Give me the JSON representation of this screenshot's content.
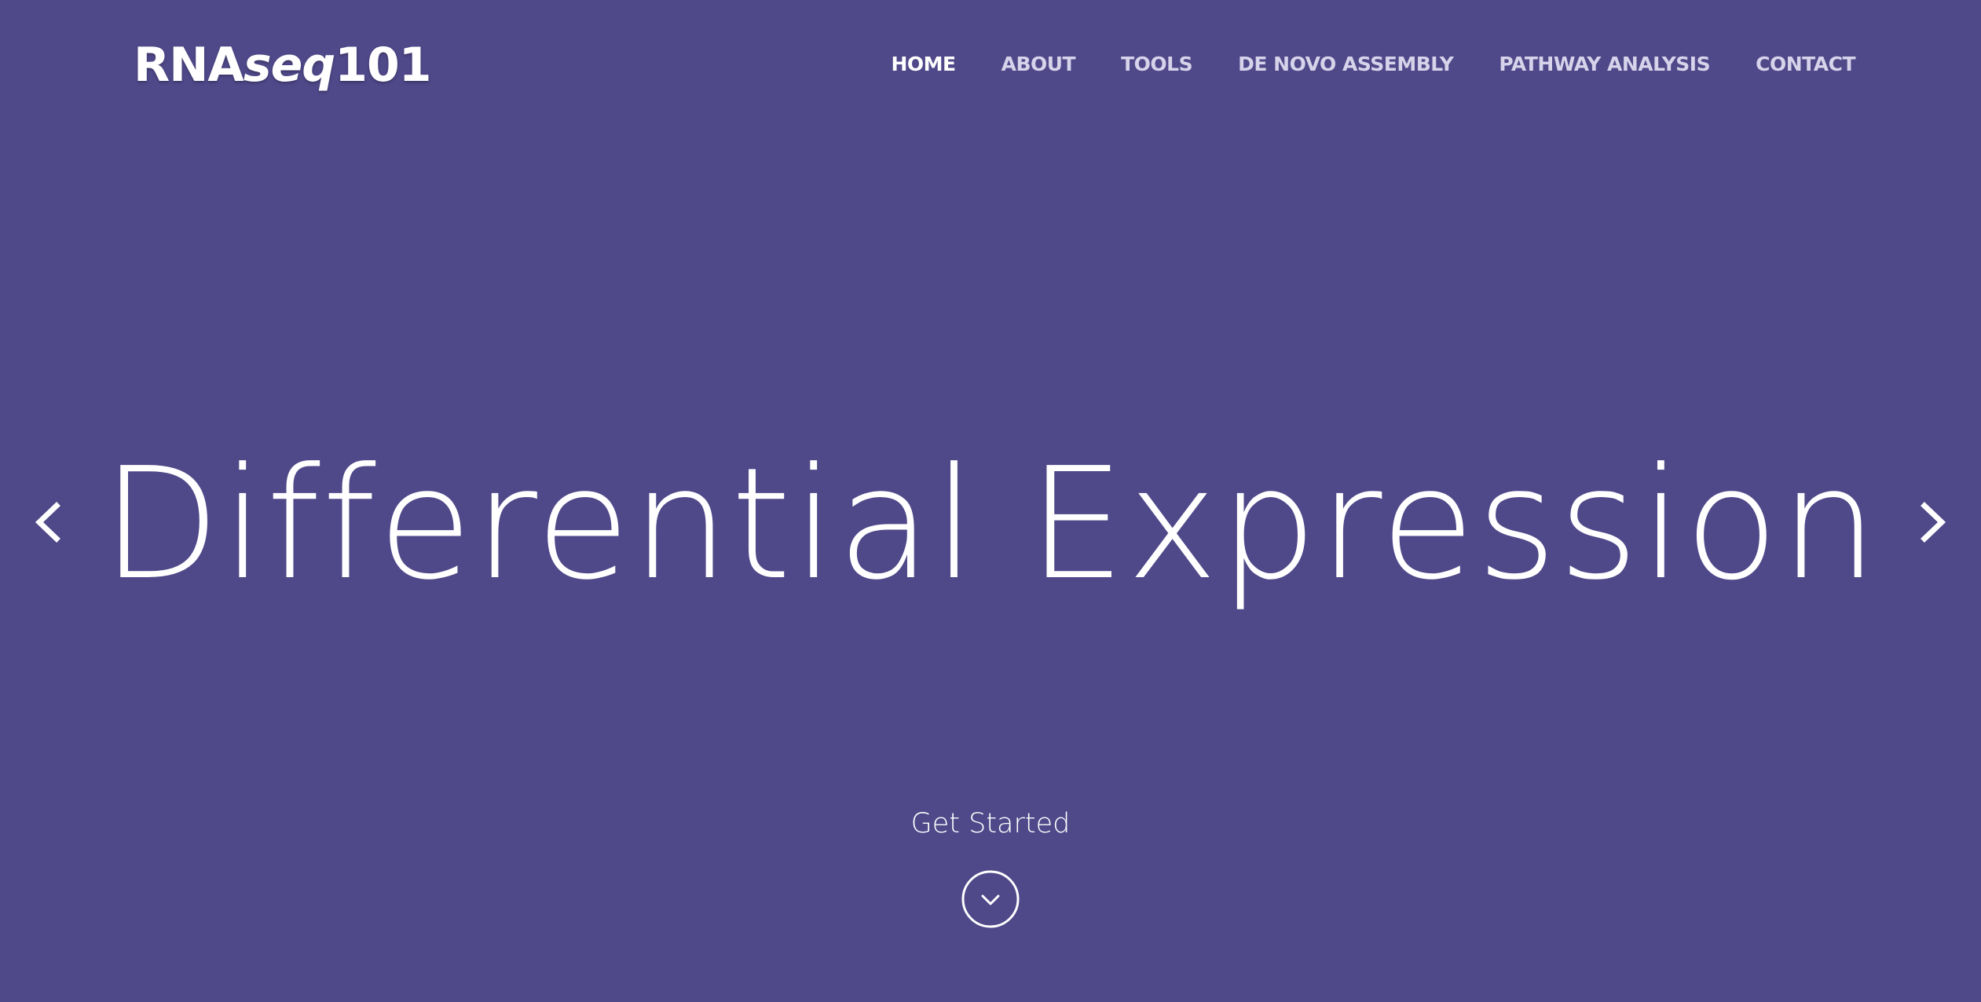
{
  "header": {
    "brand_prefix": "RNA",
    "brand_italic": "seq",
    "brand_suffix": "101"
  },
  "nav": {
    "items": [
      {
        "label": "HOME",
        "active": true
      },
      {
        "label": "ABOUT",
        "active": false
      },
      {
        "label": "TOOLS",
        "active": false
      },
      {
        "label": "DE NOVO ASSEMBLY",
        "active": false
      },
      {
        "label": "PATHWAY ANALYSIS",
        "active": false
      },
      {
        "label": "CONTACT",
        "active": false
      }
    ]
  },
  "hero": {
    "title": "Differential Expression",
    "cta_label": "Get Started",
    "prev_icon": "chevron-left-icon",
    "next_icon": "chevron-right-icon",
    "scroll_icon": "chevron-down-circle-icon"
  },
  "colors": {
    "background": "#4f4889",
    "text": "#ffffff",
    "nav_inactive": "#d6d3ea"
  }
}
